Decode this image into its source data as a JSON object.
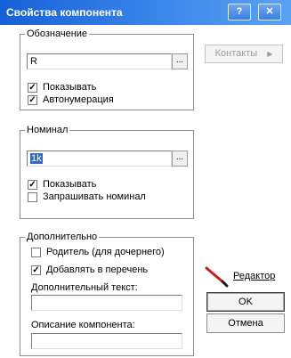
{
  "window": {
    "title": "Свойства компонента",
    "help_glyph": "?",
    "close_glyph": "✕"
  },
  "designation": {
    "group_title": "Обозначение",
    "value": "R",
    "browse_label": "...",
    "show_label": "Показывать",
    "show_checked": true,
    "autonum_label": "Автонумерация",
    "autonum_checked": true
  },
  "contacts_button": {
    "label": "Контакты",
    "arrow": "▶",
    "enabled": false
  },
  "nominal": {
    "group_title": "Номинал",
    "value": "1k",
    "browse_label": "...",
    "show_label": "Показывать",
    "show_checked": true,
    "ask_label": "Запрашивать номинал",
    "ask_checked": false
  },
  "additional": {
    "group_title": "Дополнительно",
    "parent_label": "Родитель (для дочернего)",
    "parent_checked": false,
    "add_to_list_label": "Добавлять в перечень",
    "add_to_list_checked": true,
    "extra_text_label": "Дополнительный текст:",
    "extra_text_value": "",
    "description_label": "Описание компонента:",
    "description_value": ""
  },
  "buttons": {
    "editor_label": "Редактор",
    "ok_label": "OK",
    "cancel_label": "Отмена"
  },
  "check_glyph": "✓"
}
